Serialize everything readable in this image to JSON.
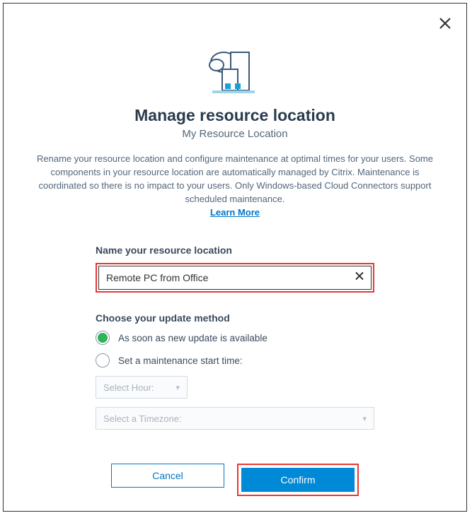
{
  "dialog": {
    "title": "Manage resource location",
    "subtitle": "My Resource Location",
    "description": "Rename your resource location and configure maintenance at optimal times for your users. Some components in your resource location are automatically managed by Citrix. Maintenance is coordinated so there is no impact to your users. Only Windows-based Cloud Connectors support scheduled maintenance.",
    "learn_more": "Learn More"
  },
  "form": {
    "name_label": "Name your resource location",
    "name_value": "Remote PC from Office",
    "update_label": "Choose your update method",
    "options": {
      "asap": "As soon as new update is available",
      "scheduled": "Set a maintenance start time:"
    },
    "selected_option": "asap",
    "select_hour_placeholder": "Select Hour:",
    "select_tz_placeholder": "Select a Timezone:"
  },
  "buttons": {
    "cancel": "Cancel",
    "confirm": "Confirm"
  }
}
